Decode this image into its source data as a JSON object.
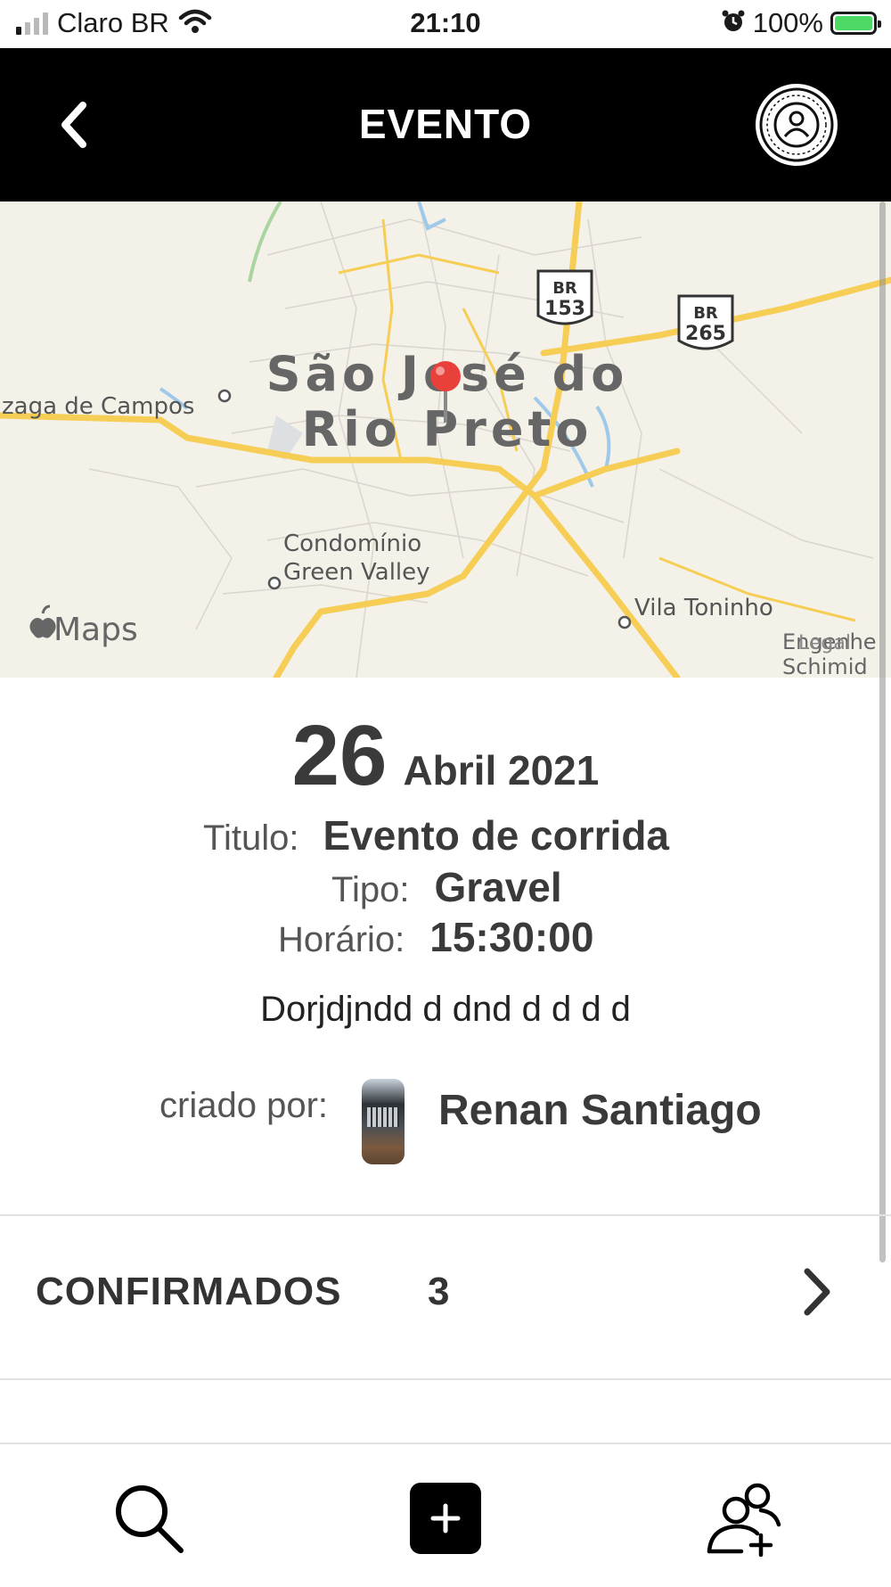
{
  "status_bar": {
    "carrier": "Claro BR",
    "time": "21:10",
    "battery": "100%"
  },
  "header": {
    "title": "EVENTO"
  },
  "map": {
    "city_line1": "São José do",
    "city_line2": "Rio Preto",
    "place_left": "zaga de Campos",
    "place_condo_line1": "Condomínio",
    "place_condo_line2": "Green Valley",
    "place_vila": "Vila Toninho",
    "place_edge_line1": "Engenhe",
    "place_edge_line2": "Schimid",
    "legal_text": "Legal",
    "highway1_line1": "BR",
    "highway1_line2": "153",
    "highway2_line1": "BR",
    "highway2_line2": "265",
    "attribution": "Maps"
  },
  "event": {
    "day": "26",
    "month_year": "Abril 2021",
    "title_label": "Titulo:",
    "title_value": "Evento de corrida",
    "type_label": "Tipo:",
    "type_value": "Gravel",
    "time_label": "Horário:",
    "time_value": "15:30:00",
    "description": "Dorjdjndd d dnd d d d d",
    "created_by_label": "criado por:",
    "creator_name": "Renan Santiago"
  },
  "confirmed": {
    "label": "CONFIRMADOS",
    "count": "3"
  },
  "tab_bar": {
    "items": [
      "search-icon",
      "add-icon",
      "add-user-icon"
    ]
  },
  "colors": {
    "header_bg": "#000000",
    "road_yellow": "#f6cd55",
    "map_bg": "#f4f1e8",
    "pin_red": "#e8403a",
    "text_dark": "#333333"
  }
}
